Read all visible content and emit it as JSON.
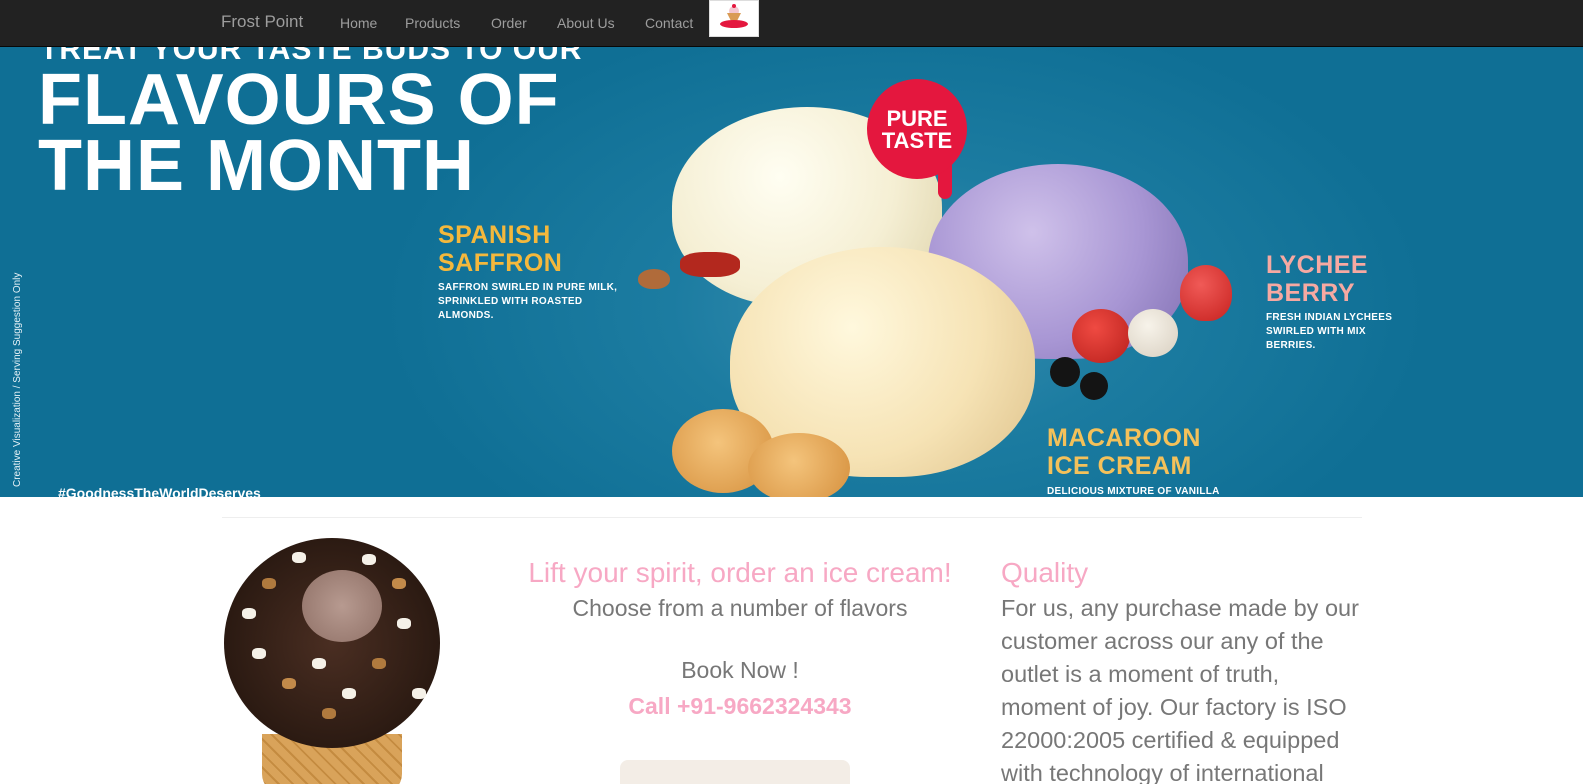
{
  "navbar": {
    "brand": "Frost Point",
    "links": [
      "Home",
      "Products",
      "Order",
      "About Us",
      "Contact"
    ],
    "logo_icon": "ice-cream-logo-icon"
  },
  "hero": {
    "top_line": "TREAT YOUR TASTE BUDS TO OUR",
    "title_line1": "FLAVOURS OF",
    "title_line2": "THE MONTH",
    "badge_line1": "PURE",
    "badge_line2": "TASTE",
    "flavors": [
      {
        "name": "SPANISH\nSAFFRON",
        "description": "SAFFRON SWIRLED IN PURE MILK,\nSPRINKLED WITH ROASTED\nALMONDS.",
        "color": "#f4b83c"
      },
      {
        "name": "LYCHEE\nBERRY",
        "description": "FRESH INDIAN LYCHEES\nSWIRLED WITH MIX\nBERRIES.",
        "color": "#f6a9a2"
      },
      {
        "name": "MACAROON\nICE CREAM",
        "description": "DELICIOUS MIXTURE OF VANILLA",
        "color": "#f4c15a"
      }
    ],
    "vertical_note": "Creative Visualization / Serving Suggestion Only",
    "hashtag": "#GoodnessTheWorldDeserves"
  },
  "promo": {
    "heading": "Lift your spirit, order an ice cream!",
    "subheading": "Choose from a number of flavors",
    "book_now": "Book Now !",
    "call": "Call +91-9662324343"
  },
  "quality": {
    "title": "Quality",
    "body": "For us, any purchase made by our customer across our any of the outlet is a moment of truth, moment of joy. Our factory is ISO 22000:2005 certified & equipped with technology of international"
  },
  "colors": {
    "navbar_bg": "#222222",
    "nav_text": "#9d9d9d",
    "hero_bg": "#1c7ca1",
    "accent_pink": "#f7a8c4",
    "body_text": "#777777",
    "badge_red": "#e4173e"
  }
}
